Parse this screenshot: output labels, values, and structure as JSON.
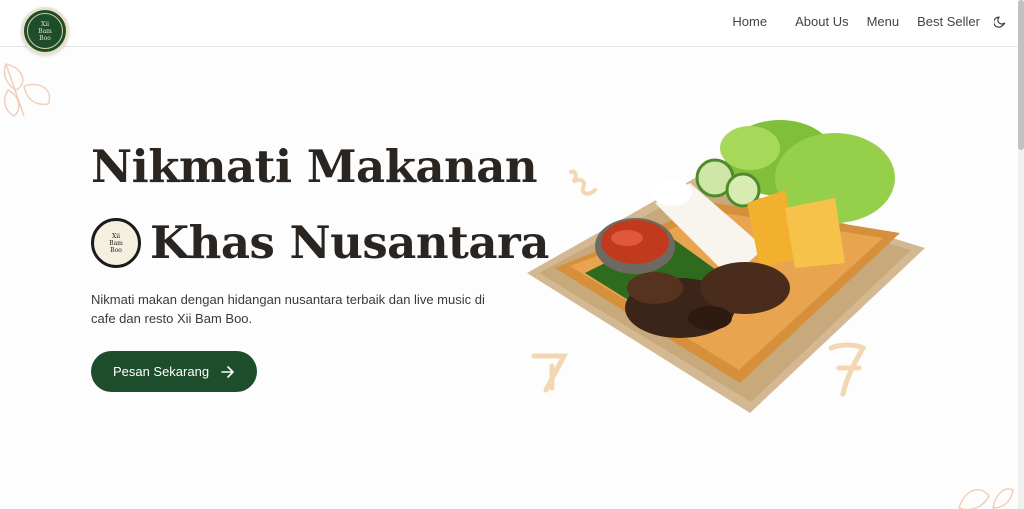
{
  "brand": {
    "logo_text": "Xii\nBam\nBoo"
  },
  "nav": {
    "items": [
      {
        "label": "Home"
      },
      {
        "label": "About Us"
      },
      {
        "label": "Menu"
      },
      {
        "label": "Best Seller"
      }
    ],
    "theme_toggle_icon": "moon-icon"
  },
  "hero": {
    "title_line1": "Nikmati Makanan",
    "title_line2": "Khas Nusantara",
    "description": "Nikmati makan dengan hidangan nusantara terbaik dan live music di cafe dan resto Xii Bam Boo.",
    "cta_label": "Pesan Sekarang",
    "cta_icon": "arrow-right-icon",
    "image": "food-plate-image"
  },
  "colors": {
    "brand_green": "#1e4d2b",
    "text_dark": "#2a2521",
    "accent_peach": "#f3d7b0"
  }
}
